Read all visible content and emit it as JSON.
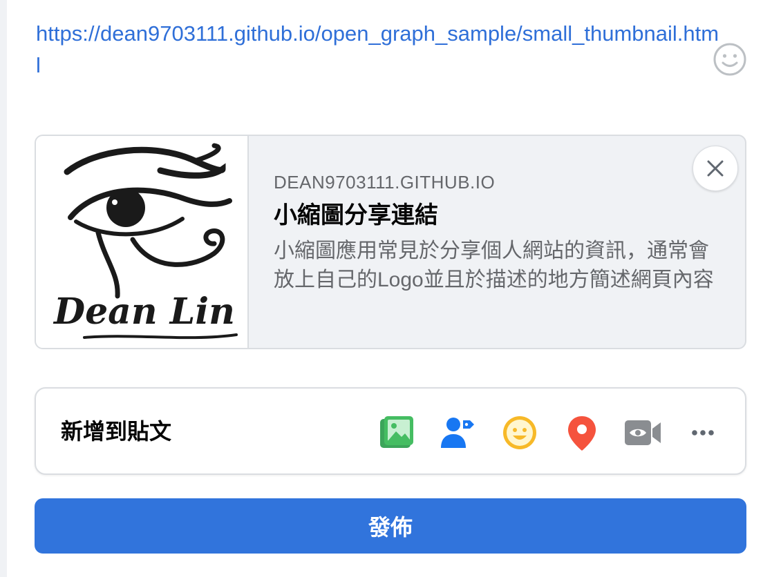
{
  "composer": {
    "url": "https://dean9703111.github.io/open_graph_sample/small_thumbnail.html"
  },
  "icons": {
    "emoji": "smiley-icon",
    "close": "close-icon",
    "photo": "photo-icon",
    "tag": "tag-people-icon",
    "feeling": "feeling-icon",
    "location": "location-pin-icon",
    "video": "live-video-icon",
    "more": "more-icon"
  },
  "link_preview": {
    "logo_text": "Dean Lin",
    "domain": "DEAN9703111.GITHUB.IO",
    "title": "小縮圖分享連結",
    "description": "小縮圖應用常見於分享個人網站的資訊，通常會放上自己的Logo並且於描述的地方簡述網頁內容"
  },
  "add_to_post": {
    "label": "新增到貼文"
  },
  "post_button": {
    "label": "發佈"
  },
  "colors": {
    "link": "#2f6fd8",
    "button": "#3174dc",
    "photo": "#45bd62",
    "tag": "#1877f2",
    "feeling": "#f7b928",
    "location": "#f5533d",
    "video": "#8a8d91"
  }
}
